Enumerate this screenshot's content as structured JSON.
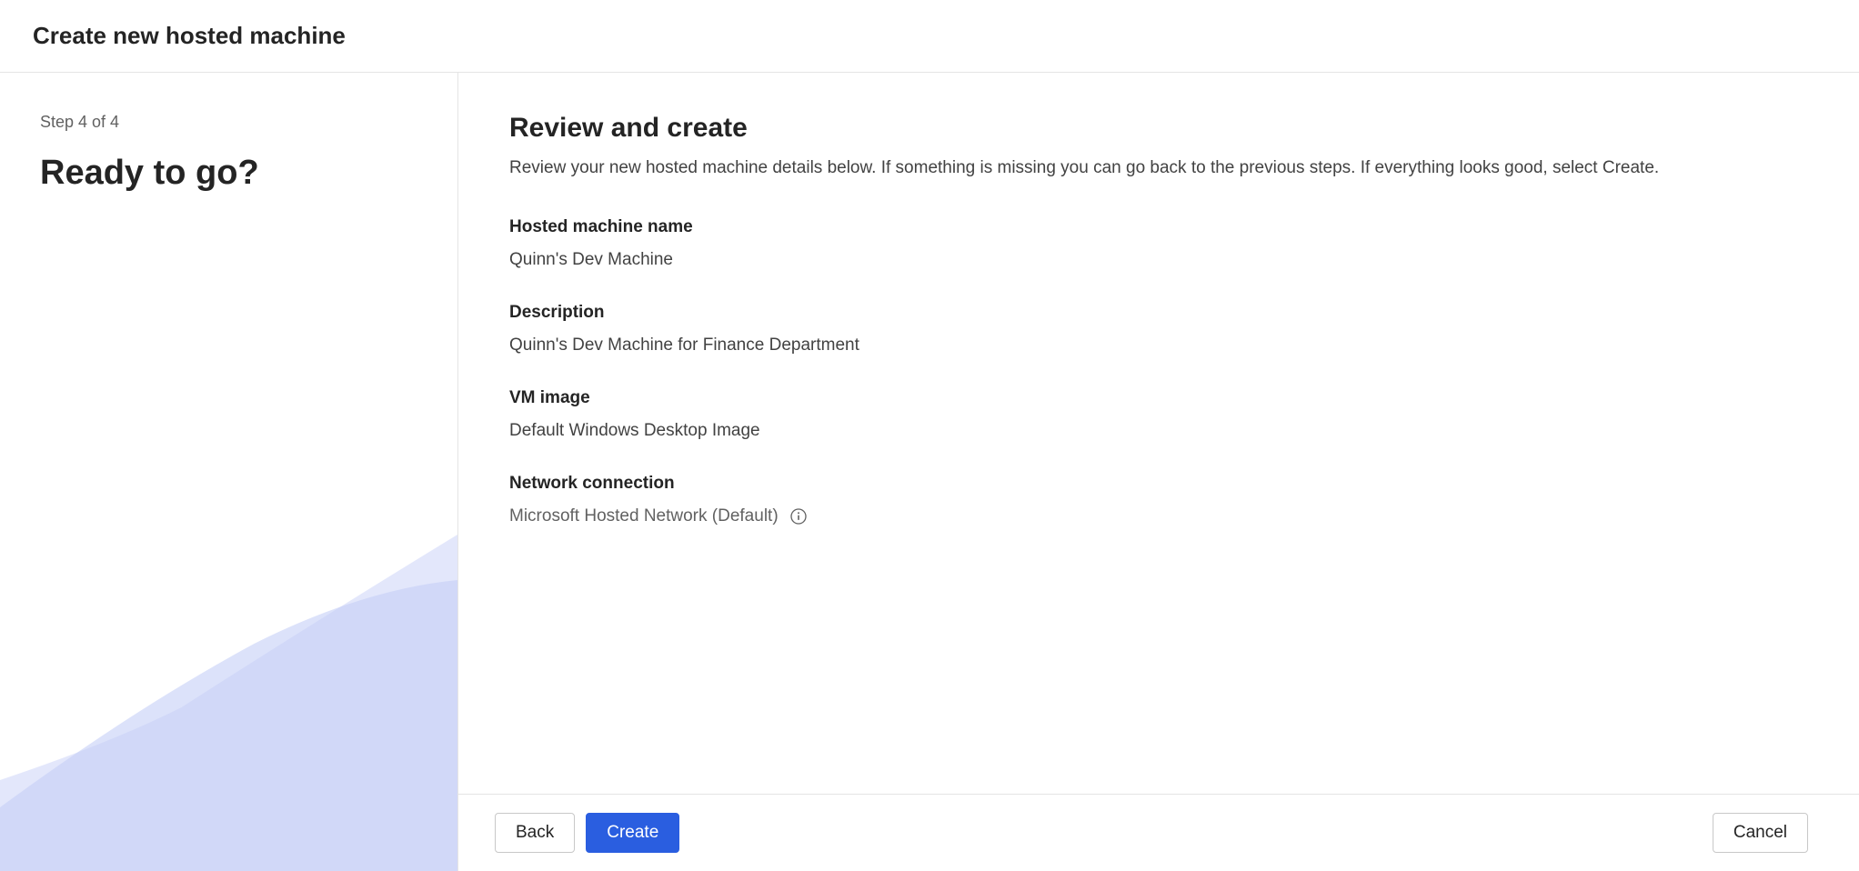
{
  "header": {
    "title": "Create new hosted machine"
  },
  "sidebar": {
    "step_label": "Step 4 of 4",
    "title": "Ready to go?"
  },
  "main": {
    "title": "Review and create",
    "subtitle": "Review your new hosted machine details below. If something is missing you can go back to the previous steps. If everything looks good, select Create.",
    "fields": {
      "name": {
        "label": "Hosted machine name",
        "value": "Quinn's Dev Machine"
      },
      "description": {
        "label": "Description",
        "value": "Quinn's Dev Machine for Finance Department"
      },
      "vm_image": {
        "label": "VM image",
        "value": "Default Windows Desktop Image"
      },
      "network": {
        "label": "Network connection",
        "value": "Microsoft Hosted Network (Default)"
      }
    }
  },
  "footer": {
    "back_label": "Back",
    "create_label": "Create",
    "cancel_label": "Cancel"
  }
}
